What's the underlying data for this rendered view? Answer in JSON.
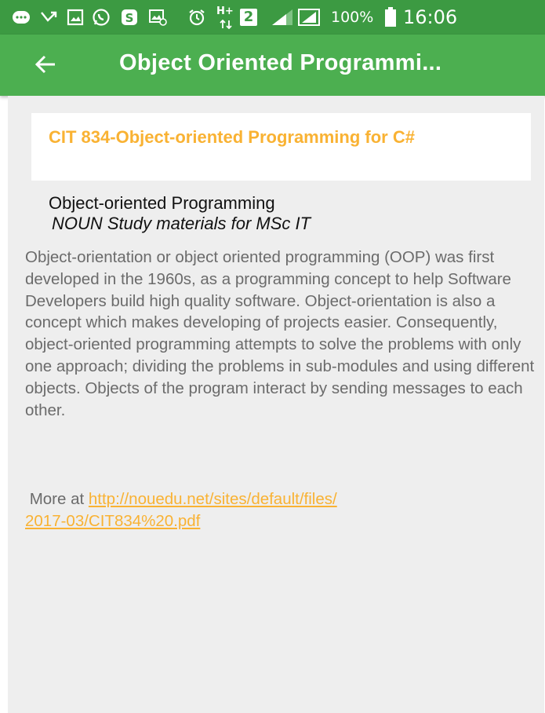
{
  "status_bar": {
    "battery_percent": "100%",
    "time": "16:06",
    "sim_label": "2",
    "network_label": "H+"
  },
  "app_bar": {
    "title": "Object Oriented Programmi..."
  },
  "card": {
    "title": "CIT 834-Object-oriented Programming for C#"
  },
  "subtitle": {
    "line1": "Object-oriented Programming",
    "line2": " NOUN Study materials for MSc IT"
  },
  "body": {
    "paragraph": "Object-orientation or object oriented programming (OOP) was first developed in the 1960s, as a programming concept to help Software Developers build high quality software. Object-orientation is also a concept which makes developing of projects easier. Consequently, object-oriented programming attempts to solve the problems with only one approach; dividing the problems in sub-modules and using different objects. Objects of the program interact by sending messages to each other.",
    "more_prefix": " More at ",
    "more_link_line1": "http://nouedu.net/sites/default/files/",
    "more_link_line2": "2017-03/CIT834%20.pdf"
  },
  "colors": {
    "status_bar_bg": "#3c9a42",
    "app_bar_bg": "#4caf50",
    "accent": "#f9b233",
    "content_bg": "#eeeeee"
  }
}
